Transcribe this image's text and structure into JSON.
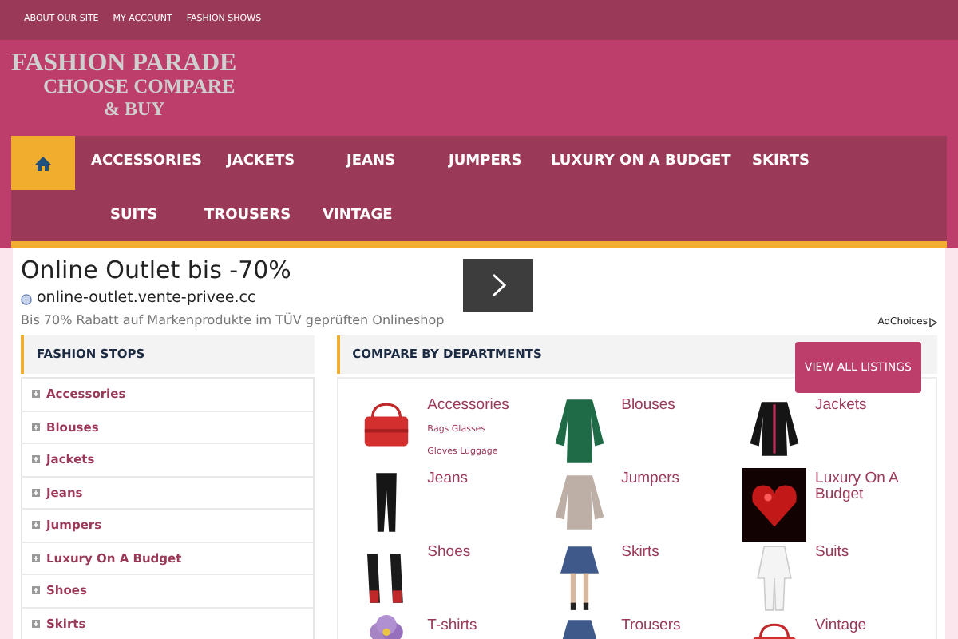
{
  "top_links": [
    "ABOUT OUR SITE",
    "MY ACCOUNT",
    "FASHION SHOWS"
  ],
  "logo": {
    "lines": [
      "FASHION PARADE",
      "CHOOSE COMPARE",
      "& BUY"
    ]
  },
  "nav": {
    "items": [
      {
        "label": "ACCESSORIES",
        "selected": false
      },
      {
        "label": "JACKETS",
        "selected": false
      },
      {
        "label": "JEANS",
        "selected": false
      },
      {
        "label": "JUMPERS",
        "selected": false
      },
      {
        "label": "LUXURY ON A BUDGET",
        "selected": false
      },
      {
        "label": "SKIRTS",
        "selected": false
      },
      {
        "label": "SUITS",
        "selected": false
      },
      {
        "label": "TROUSERS",
        "selected": false
      },
      {
        "label": "VINTAGE",
        "selected": false
      }
    ],
    "home_selected": true
  },
  "ad": {
    "title": "Online Outlet bis -70%",
    "url": "online-outlet.vente-privee.cc",
    "text": "Bis 70% Rabatt auf Markenprodukte im TÜV geprüften Onlineshop",
    "choices": "AdChoices"
  },
  "sidebar": {
    "title": "FASHION STOPS",
    "items": [
      "Accessories",
      "Blouses",
      "Jackets",
      "Jeans",
      "Jumpers",
      "Luxury On A Budget",
      "Shoes",
      "Skirts"
    ]
  },
  "departments": {
    "title": "COMPARE BY DEPARTMENTS",
    "button": "VIEW ALL LISTINGS",
    "items": [
      {
        "name": "Accessories",
        "sub": [
          "Bags Glasses",
          "Gloves Luggage"
        ],
        "kind": "bag"
      },
      {
        "name": "Blouses",
        "kind": "top"
      },
      {
        "name": "Jackets",
        "kind": "jacket"
      },
      {
        "name": "Jeans",
        "kind": "pants"
      },
      {
        "name": "Jumpers",
        "kind": "jumper"
      },
      {
        "name": "Luxury On A Budget",
        "kind": "heart"
      },
      {
        "name": "Shoes",
        "kind": "shoes"
      },
      {
        "name": "Skirts",
        "kind": "skirt"
      },
      {
        "name": "Suits",
        "kind": "suit"
      },
      {
        "name": "T-shirts",
        "kind": "flower"
      },
      {
        "name": "Trousers",
        "kind": "skirt"
      },
      {
        "name": "Vintage",
        "kind": "bag"
      }
    ]
  }
}
